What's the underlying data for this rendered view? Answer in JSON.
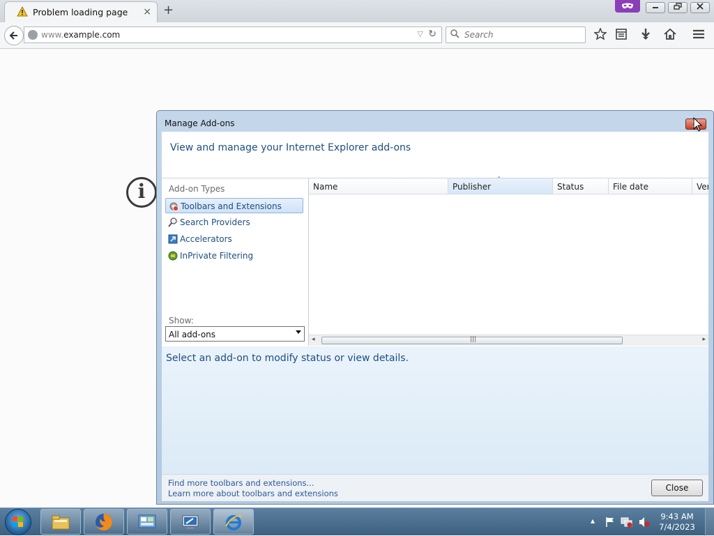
{
  "browser": {
    "tab_title": "Problem loading page",
    "new_tab_symbol": "+",
    "tab_close_symbol": "×",
    "url_prefix": "www.",
    "url_domain": "example.com",
    "search_placeholder": "Search",
    "toolbar_icons": [
      "bookmark-star-icon",
      "reading-list-icon",
      "download-icon",
      "home-icon",
      "menu-icon"
    ],
    "private_browsing_icon": "mask-icon"
  },
  "dialog": {
    "title": "Manage Add-ons",
    "header": "View and manage your Internet Explorer add-ons",
    "addon_types_label": "Add-on Types",
    "addon_types": [
      {
        "label": "Toolbars and Extensions",
        "icon": "gear-blocked-icon",
        "selected": true
      },
      {
        "label": "Search Providers",
        "icon": "search-icon",
        "selected": false
      },
      {
        "label": "Accelerators",
        "icon": "accelerator-icon",
        "selected": false
      },
      {
        "label": "InPrivate Filtering",
        "icon": "inprivate-icon",
        "selected": false
      }
    ],
    "show_label": "Show:",
    "show_value": "All add-ons",
    "columns": [
      "Name",
      "Publisher",
      "Status",
      "File date",
      "Ver"
    ],
    "sorted_column": "Publisher",
    "details_message": "Select an add-on to modify status or view details.",
    "footer_links": [
      "Find more toolbars and extensions...",
      "Learn more about toolbars and extensions"
    ],
    "close_button": "Close"
  },
  "taskbar": {
    "apps": [
      "explorer-icon",
      "firefox-icon",
      "control-panel-icon",
      "remote-desktop-icon",
      "internet-explorer-icon"
    ],
    "time": "9:43 AM",
    "date": "7/4/2023"
  },
  "colors": {
    "dialog_accent": "#1e4e80",
    "link": "#2a5a9c",
    "private_purple": "#8a3fb8"
  }
}
